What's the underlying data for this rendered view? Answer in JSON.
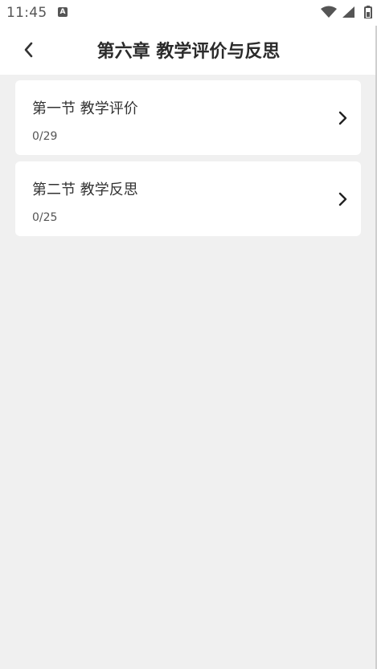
{
  "status_bar": {
    "time": "11:45",
    "notification_icon": "A"
  },
  "header": {
    "title": "第六章 教学评价与反思",
    "back_icon": "chevron-left-icon"
  },
  "sections": [
    {
      "title": "第一节 教学评价",
      "progress": "0/29"
    },
    {
      "title": "第二节 教学反思",
      "progress": "0/25"
    }
  ],
  "colors": {
    "background": "#f0f0f0",
    "card": "#ffffff",
    "text": "#333333"
  }
}
